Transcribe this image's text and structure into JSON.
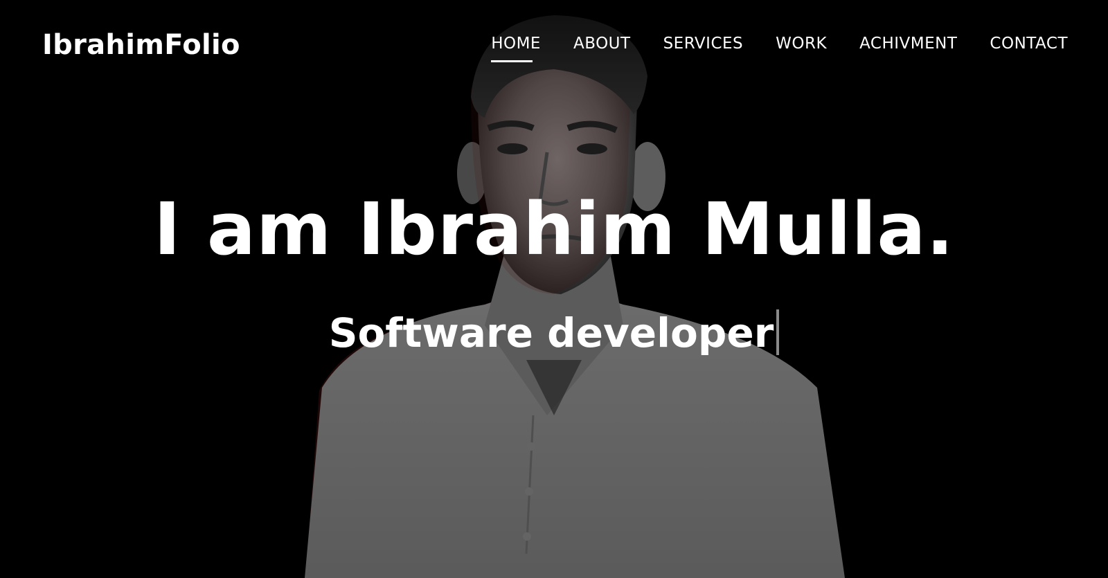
{
  "site": {
    "logo": "IbrahimFolio"
  },
  "nav": {
    "items": [
      {
        "label": "HOME",
        "active": true
      },
      {
        "label": "ABOUT",
        "active": false
      },
      {
        "label": "SERVICES",
        "active": false
      },
      {
        "label": "WORK",
        "active": false
      },
      {
        "label": "ACHIVMENT",
        "active": false
      },
      {
        "label": "CONTACT",
        "active": false
      }
    ]
  },
  "hero": {
    "title": "I am Ibrahim Mulla.",
    "subtitle": "Software developer"
  },
  "colors": {
    "background": "#000000",
    "text": "#ffffff",
    "cursor": "#8a8a8a"
  },
  "icons": {
    "background_image": "person-portrait"
  }
}
